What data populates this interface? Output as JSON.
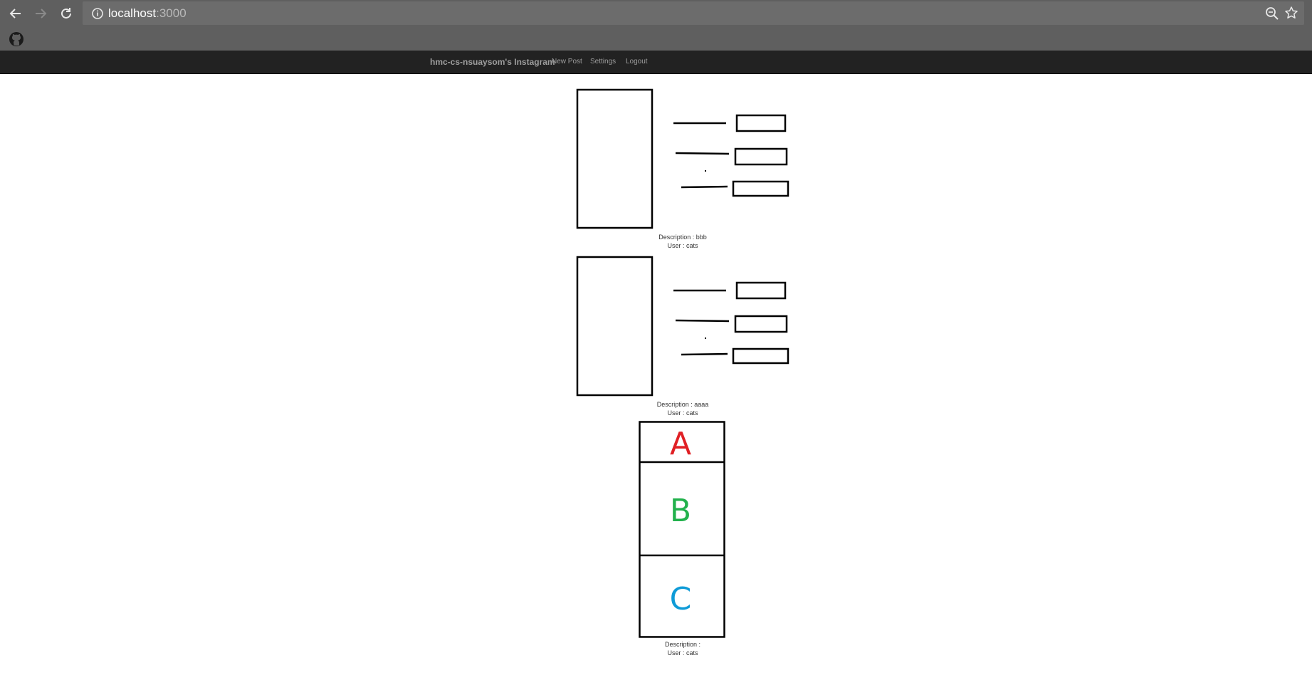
{
  "browser": {
    "url_host": "localhost",
    "url_port": ":3000",
    "icons": {
      "back": "back-arrow-icon",
      "forward": "forward-arrow-icon",
      "reload": "reload-icon",
      "info": "info-icon",
      "zoom": "zoom-icon",
      "bookmark": "star-icon",
      "github": "github-icon"
    }
  },
  "navbar": {
    "brand": "hmc-cs-nsuaysom's Instagram",
    "links": [
      "New Post",
      "Settings",
      "Logout"
    ]
  },
  "posts": [
    {
      "description_label": "Description : bbb",
      "user_label": "User : cats"
    },
    {
      "description_label": "Description : aaaa",
      "user_label": "User : cats"
    },
    {
      "description_label": "Description :",
      "user_label": "User : cats"
    }
  ],
  "abc_image": {
    "letters": [
      "A",
      "B",
      "C"
    ],
    "colors": [
      "#e02025",
      "#22b14c",
      "#0f9bd7"
    ]
  },
  "colors": {
    "chrome": "#5f5f5f",
    "omnibox": "#6c6c6c",
    "navbar": "#222222",
    "navbar_text": "#9d9d9d"
  }
}
